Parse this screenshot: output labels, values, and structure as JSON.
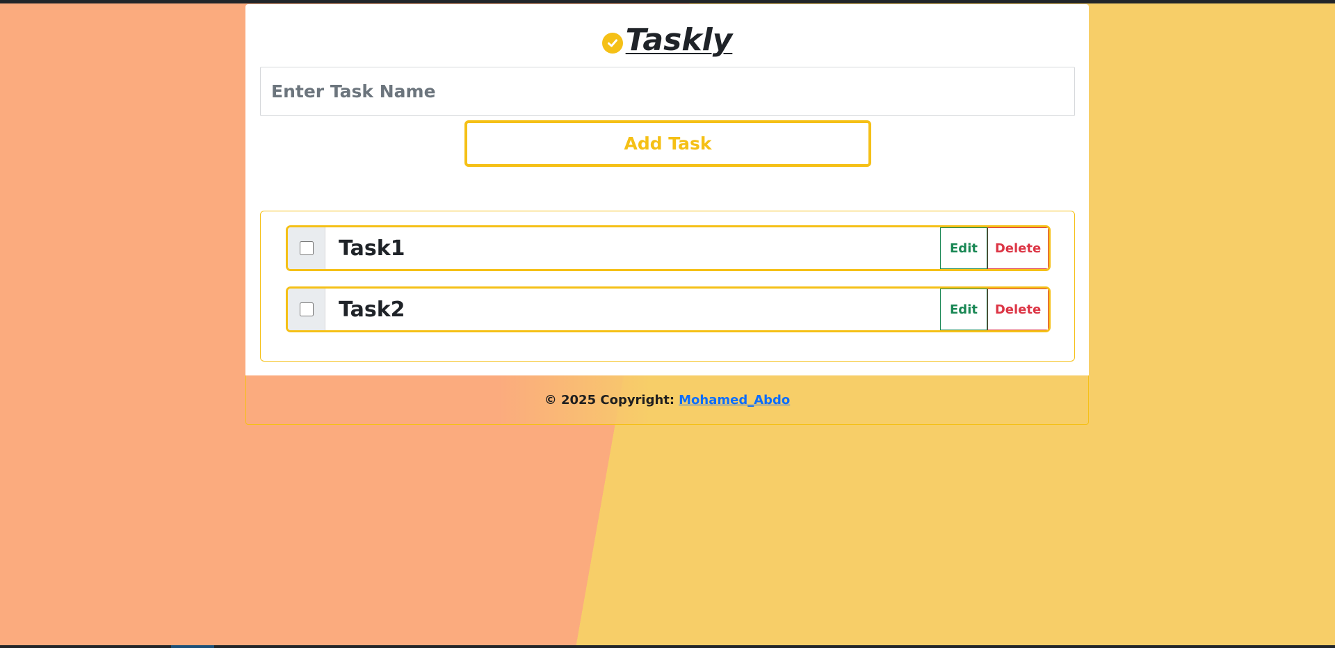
{
  "app": {
    "title": "Taskly",
    "title_icon": "check-circle-icon",
    "accent_color": "#f5c016"
  },
  "form": {
    "task_input_placeholder": "Enter Task Name",
    "task_input_value": "",
    "add_button_label": "Add Task"
  },
  "tasks": [
    {
      "label": "Task1",
      "checked": false,
      "edit_label": "Edit",
      "delete_label": "Delete"
    },
    {
      "label": "Task2",
      "checked": false,
      "edit_label": "Edit",
      "delete_label": "Delete"
    }
  ],
  "footer": {
    "copyright_text": "© 2025 Copyright:",
    "author_link": "Mohamed_Abdo"
  },
  "colors": {
    "background_left": "#fbab7e",
    "background_right": "#f7ce68",
    "edit_color": "#198754",
    "delete_color": "#dc3545",
    "link_color": "#0d6efd"
  }
}
